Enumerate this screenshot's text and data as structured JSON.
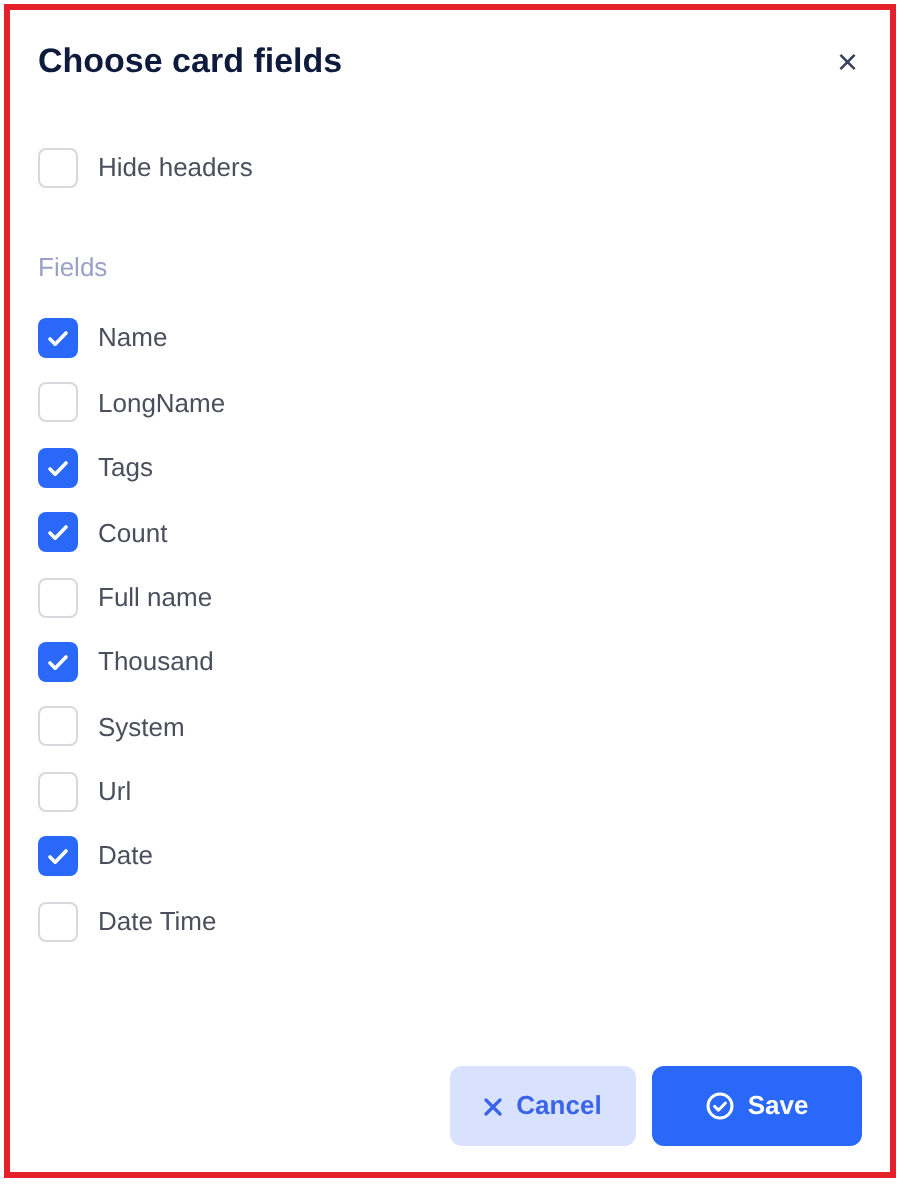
{
  "dialog": {
    "title": "Choose card fields",
    "close": "×"
  },
  "hide_headers": {
    "label": "Hide headers",
    "checked": false
  },
  "fields_label": "Fields",
  "fields": [
    {
      "label": "Name",
      "checked": true
    },
    {
      "label": "LongName",
      "checked": false
    },
    {
      "label": "Tags",
      "checked": true
    },
    {
      "label": "Count",
      "checked": true
    },
    {
      "label": "Full name",
      "checked": false
    },
    {
      "label": "Thousand",
      "checked": true
    },
    {
      "label": "System",
      "checked": false
    },
    {
      "label": "Url",
      "checked": false
    },
    {
      "label": "Date",
      "checked": true
    },
    {
      "label": "Date Time",
      "checked": false
    }
  ],
  "buttons": [
    {
      "kind": "cancel",
      "label": "Cancel"
    },
    {
      "kind": "save",
      "label": "Save"
    }
  ]
}
